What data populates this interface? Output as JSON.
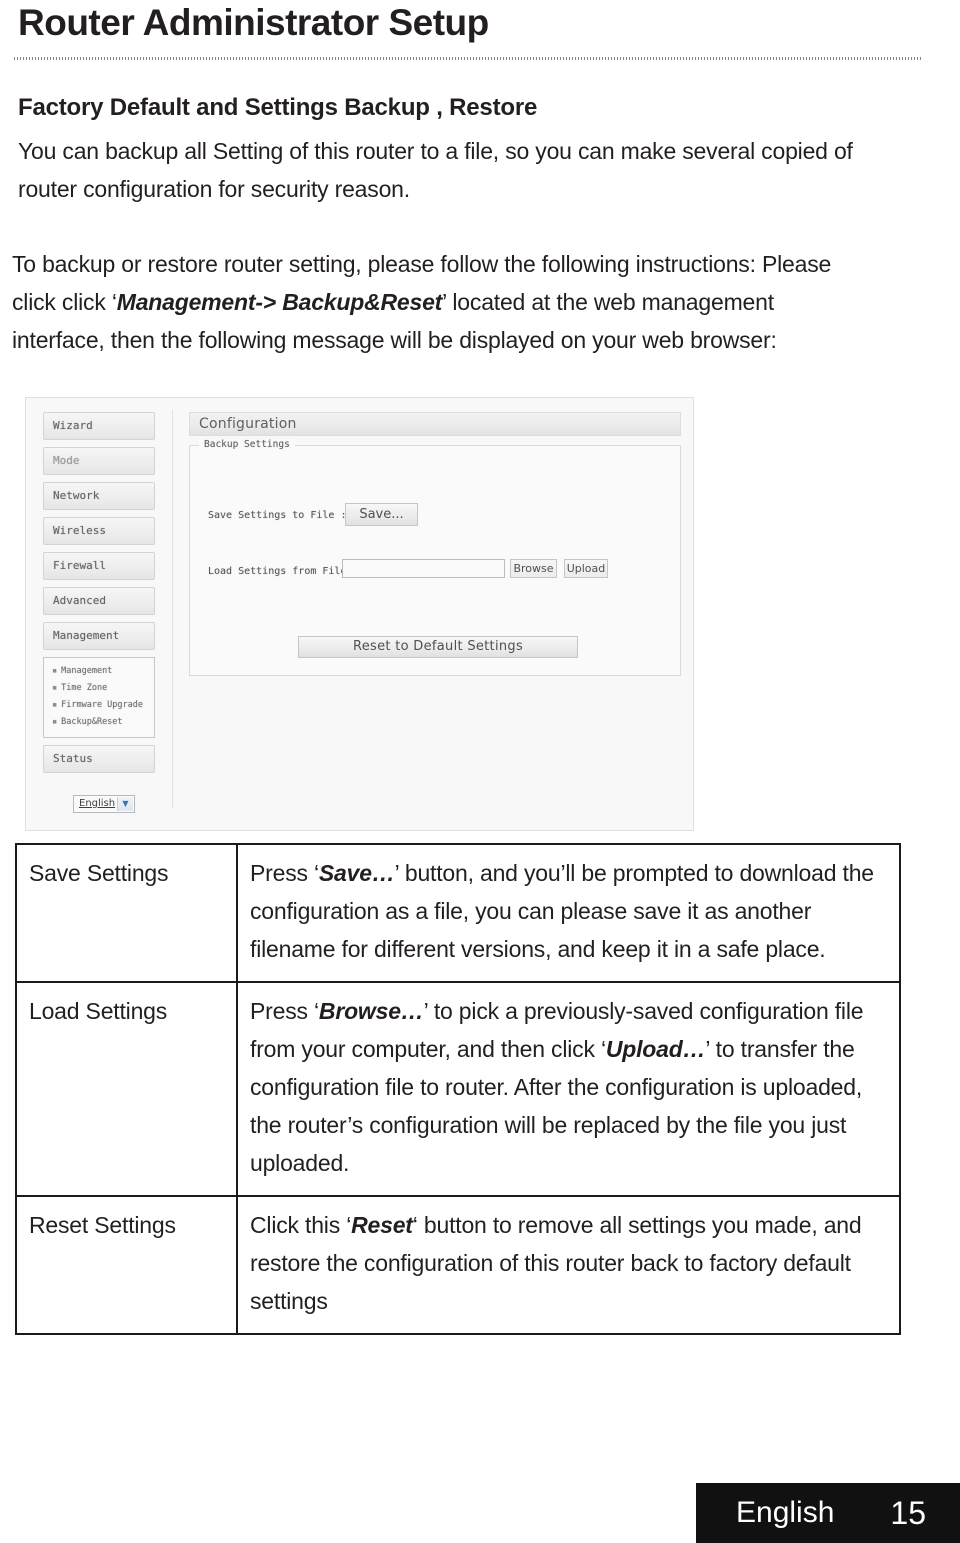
{
  "page": {
    "title": "Router Administrator Setup",
    "section_heading": "Factory Default  and Settings Backup , Restore",
    "intro_paragraph_1": "You can backup all Setting of this router to a file, so you can make several copied of router configuration for security reason.",
    "intro_paragraph_2_before": "To backup or restore router setting, please follow the following instructions: Please click click ‘",
    "intro_paragraph_2_emphasis": "Management-> Backup&Reset",
    "intro_paragraph_2_after": "’ located at the web management interface, then the following message will be displayed on your web browser:"
  },
  "screenshot": {
    "nav_items": [
      {
        "label": "Wizard"
      },
      {
        "label": "Mode"
      },
      {
        "label": "Network"
      },
      {
        "label": "Wireless"
      },
      {
        "label": "Firewall"
      },
      {
        "label": "Advanced"
      },
      {
        "label": "Management"
      }
    ],
    "submenu_items": [
      {
        "bullet": "▪",
        "label": "Management"
      },
      {
        "bullet": "▪",
        "label": "Time Zone"
      },
      {
        "bullet": "▪",
        "label": "Firmware Upgrade"
      },
      {
        "bullet": "▪",
        "label": "Backup&Reset"
      }
    ],
    "status_item": "Status",
    "language_select": {
      "value": "English",
      "caret": "▼"
    },
    "panel": {
      "header": "Configuration",
      "legend": "Backup Settings",
      "save_label": "Save Settings to File :",
      "save_button": "Save...",
      "load_label": "Load Settings from File :",
      "load_input_value": "",
      "browse_button": "Browse",
      "upload_button": "Upload",
      "reset_button": "Reset to Default Settings"
    }
  },
  "table": {
    "rows": [
      {
        "term": "Save Settings",
        "def_before": "Press ‘",
        "def_emphasis": "Save…",
        "def_after": "’ button, and you’ll be prompted to download the configuration as a file, you can please save it as another filename for different versions, and keep it in a safe place."
      },
      {
        "term": "Load Settings",
        "def_before": "Press ‘",
        "def_emphasis": "Browse…",
        "def_mid": "’ to pick a previously-saved configuration file from your computer, and then click ‘",
        "def_emphasis2": "Upload…",
        "def_after": "’ to transfer the configuration file to router. After the configuration is uploaded, the router’s configuration will be replaced by the file you just uploaded."
      },
      {
        "term": "Reset Settings",
        "def_before": "Click this ‘",
        "def_emphasis": "Reset",
        "def_after": "‘ button to remove all settings you made, and restore the configuration of this router back to factory default settings"
      }
    ]
  },
  "footer": {
    "language": "English",
    "page_number": "15"
  }
}
